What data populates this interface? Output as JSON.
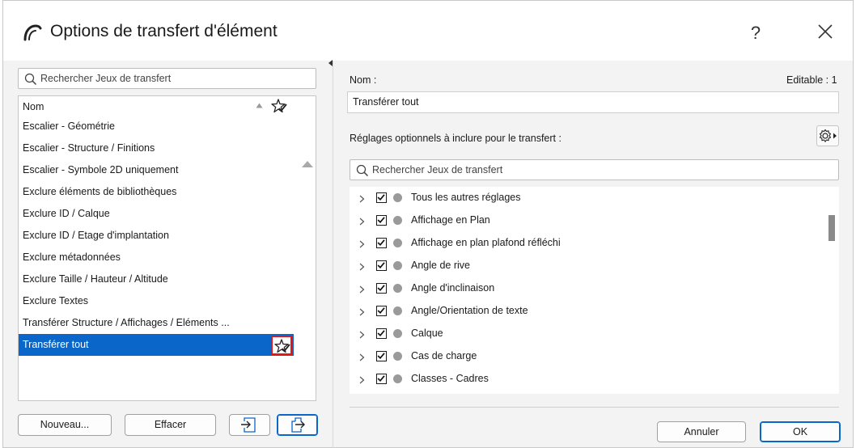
{
  "window": {
    "title": "Options de transfert d'élément",
    "help_label": "?"
  },
  "left": {
    "search_placeholder": "Rechercher Jeux de transfert",
    "column_header": "Nom",
    "items": [
      "Escalier - Géométrie",
      "Escalier - Structure / Finitions",
      "Escalier - Symbole 2D uniquement",
      "Exclure éléments de bibliothèques",
      "Exclure ID / Calque",
      "Exclure ID / Etage d'implantation",
      "Exclure métadonnées",
      "Exclure Taille / Hauteur / Altitude",
      "Exclure Textes",
      "Transférer Structure / Affichages / Eléments ...",
      "Transférer tout"
    ],
    "selected_index": 10,
    "buttons": {
      "new": "Nouveau...",
      "delete": "Effacer"
    }
  },
  "right": {
    "name_label": "Nom :",
    "editable_label": "Editable : 1",
    "name_value": "Transférer tout",
    "optional_label": "Réglages optionnels à inclure pour le transfert :",
    "search_placeholder": "Rechercher Jeux de transfert",
    "settings": [
      "Tous les autres réglages",
      "Affichage en Plan",
      "Affichage en plan plafond réfléchi",
      "Angle de rive",
      "Angle d'inclinaison",
      "Angle/Orientation de texte",
      "Calque",
      "Cas de charge",
      "Classes - Cadres"
    ],
    "buttons": {
      "cancel": "Annuler",
      "ok": "OK"
    }
  },
  "colors": {
    "selection": "#0a66c8",
    "highlight_border": "#e01818",
    "dot": "#9a9a9a"
  }
}
